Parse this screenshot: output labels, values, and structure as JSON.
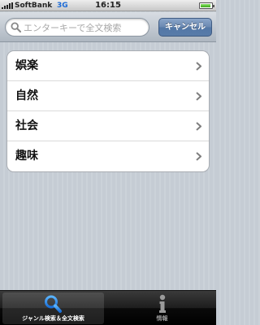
{
  "status_bar": {
    "carrier": "SoftBank",
    "network": "3G",
    "time": "16:15"
  },
  "search": {
    "placeholder": "エンターキーで全文検索",
    "value": "",
    "cancel_label": "キャンセル"
  },
  "genres": [
    {
      "label": "娯楽"
    },
    {
      "label": "自然"
    },
    {
      "label": "社会"
    },
    {
      "label": "趣味"
    }
  ],
  "tab_bar": {
    "tabs": [
      {
        "label": "ジャンル検索＆全文検索",
        "icon": "magnifier-icon",
        "selected": true
      },
      {
        "label": "情報",
        "icon": "info-icon",
        "selected": false
      }
    ]
  },
  "colors": {
    "accent_blue": "#1b83e8",
    "cancel_button": "#5f80ad",
    "background": "#c5ccd4"
  }
}
